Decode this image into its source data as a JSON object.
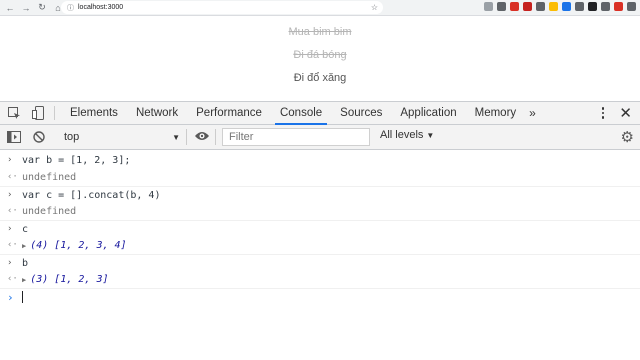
{
  "browser": {
    "url": "localhost:3000",
    "nav_icons": [
      "back-icon",
      "forward-icon",
      "reload-icon",
      "home-icon"
    ],
    "extension_colors": [
      "#9aa0a6",
      "#5f6368",
      "#d93025",
      "#c5221f",
      "#5f6368",
      "#fbbc04",
      "#1a73e8",
      "#5f6368",
      "#202124",
      "#5f6368",
      "#d93025",
      "#5f6368"
    ]
  },
  "page": {
    "todos": [
      {
        "text": "Mua bim bim",
        "done": true
      },
      {
        "text": "Đi đá bóng",
        "done": true
      },
      {
        "text": "Đi đổ xăng",
        "done": false
      }
    ]
  },
  "devtools": {
    "tabs": [
      "Elements",
      "Network",
      "Performance",
      "Console",
      "Sources",
      "Application",
      "Memory"
    ],
    "active_tab": "Console",
    "more_tabs": "»",
    "context": "top",
    "filter_placeholder": "Filter",
    "levels": "All levels",
    "accent": "#1a73e8"
  },
  "console": {
    "entries": [
      {
        "kind": "input",
        "text": "var b = [1, 2, 3];"
      },
      {
        "kind": "result",
        "text": "undefined"
      },
      {
        "kind": "input",
        "text": "var c = [].concat(b, 4)"
      },
      {
        "kind": "result",
        "text": "undefined"
      },
      {
        "kind": "input",
        "text": "c"
      },
      {
        "kind": "array",
        "text": "(4) [1, 2, 3, 4]"
      },
      {
        "kind": "input",
        "text": "b"
      },
      {
        "kind": "array",
        "text": "(3) [1, 2, 3]"
      }
    ],
    "prompt_symbol": "›",
    "input_symbol": "›",
    "result_symbol": "‹·"
  }
}
